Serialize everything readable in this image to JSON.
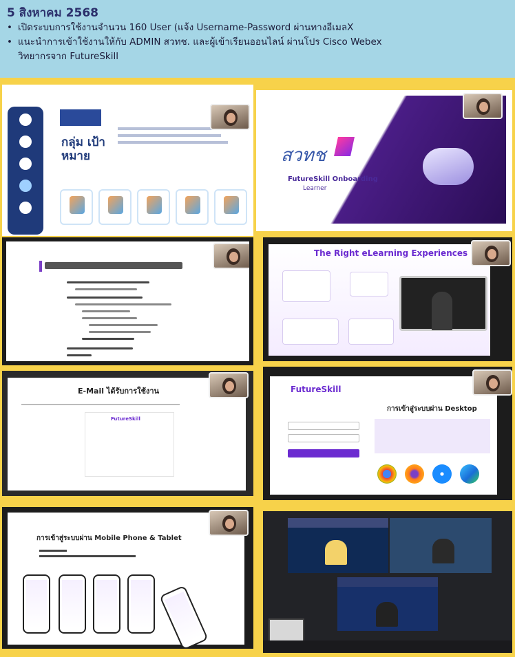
{
  "header": {
    "date": "5 สิงหาคม 2568",
    "bullet1": "เปิดระบบการใช้งานจำนวน 160 User (แจ้ง Username-Password ผ่านทางอีเมลX",
    "bullet2": "แนะนำการเข้าใช้งานให้กับ ADMIN สวทช. และผู้เข้าเรียนออนไลน์ ผ่านโปร Cisco Webex",
    "bullet2_cont": "วิทยากรจาก FutureSkill",
    "bullet_char": "•"
  },
  "slides": {
    "slide1_title": "กลุ่ม เป้าหมาย",
    "slide2_caption": "FutureSkill Onboarding",
    "slide2_sub": "Learner",
    "slide4_title": "The Right eLearning Experiences",
    "slide5_title": "E-Mail ได้รับการใช้งาน",
    "slide5_brand": "FutureSkill",
    "slide6_logo": "FutureSkill",
    "slide6_title": "การเข้าสู่ระบบผ่าน Desktop",
    "slide7_title": "การเข้าสู่ระบบผ่าน Mobile Phone & Tablet"
  },
  "colors": {
    "header_bg": "#a5d6e6",
    "collage_bg": "#f7d24a",
    "accent_purple": "#6b2bd0",
    "navy": "#1f3a7a"
  }
}
